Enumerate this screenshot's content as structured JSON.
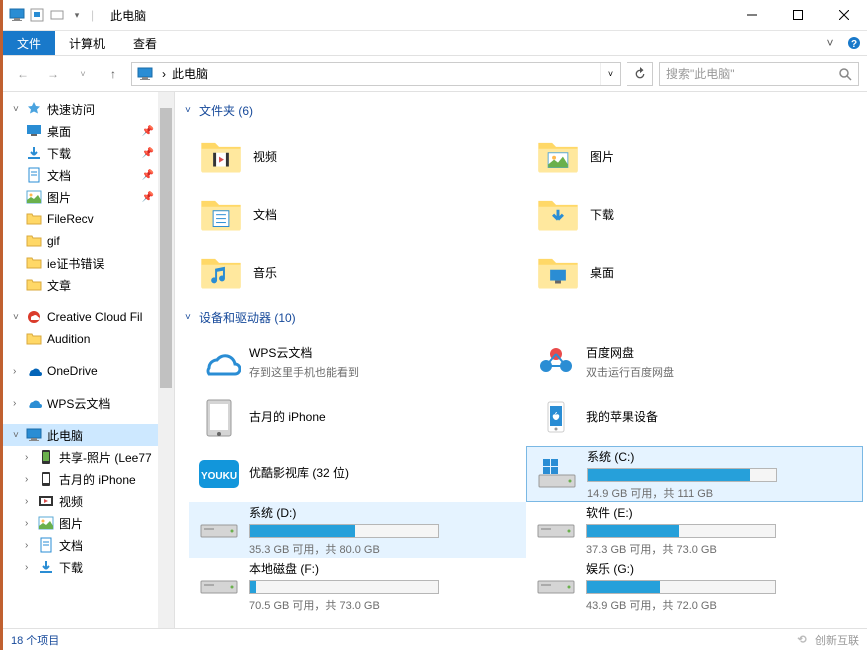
{
  "title_bar": {
    "title": "此电脑"
  },
  "ribbon": {
    "file": "文件",
    "computer": "计算机",
    "view": "查看"
  },
  "address": {
    "separator": "›",
    "path": "此电脑",
    "search_placeholder": "搜索\"此电脑\""
  },
  "sidebar": {
    "quickaccess": {
      "label": "快速访问"
    },
    "quickaccess_items": [
      {
        "label": "桌面",
        "pinned": true,
        "icon": "desktop"
      },
      {
        "label": "下载",
        "pinned": true,
        "icon": "downloads"
      },
      {
        "label": "文档",
        "pinned": true,
        "icon": "documents"
      },
      {
        "label": "图片",
        "pinned": true,
        "icon": "pictures"
      },
      {
        "label": "FileRecv",
        "pinned": false,
        "icon": "folder"
      },
      {
        "label": "gif",
        "pinned": false,
        "icon": "folder"
      },
      {
        "label": "ie证书错误",
        "pinned": false,
        "icon": "folder"
      },
      {
        "label": "文章",
        "pinned": false,
        "icon": "folder"
      }
    ],
    "cloud": [
      {
        "label": "Creative Cloud Fil",
        "icon": "cc"
      },
      {
        "label": "Audition",
        "icon": "folder",
        "lvl": 1
      }
    ],
    "onedrive": {
      "label": "OneDrive"
    },
    "wps": {
      "label": "WPS云文档"
    },
    "thispc": {
      "label": "此电脑"
    },
    "thispc_items": [
      {
        "label": "共享-照片 (Lee77",
        "icon": "phone-green"
      },
      {
        "label": "古月的 iPhone",
        "icon": "phone"
      },
      {
        "label": "视频",
        "icon": "videos"
      },
      {
        "label": "图片",
        "icon": "pictures"
      },
      {
        "label": "文档",
        "icon": "documents"
      },
      {
        "label": "下载",
        "icon": "downloads"
      }
    ]
  },
  "content": {
    "folders_header": "文件夹 (6)",
    "folders": [
      {
        "name": "视频",
        "icon": "videos"
      },
      {
        "name": "图片",
        "icon": "pictures"
      },
      {
        "name": "文档",
        "icon": "documents"
      },
      {
        "name": "下载",
        "icon": "downloads"
      },
      {
        "name": "音乐",
        "icon": "music"
      },
      {
        "name": "桌面",
        "icon": "desktop"
      }
    ],
    "devices_header": "设备和驱动器 (10)",
    "devices": [
      {
        "title": "WPS云文档",
        "sub": "存到这里手机也能看到",
        "icon": "wps-cloud"
      },
      {
        "title": "百度网盘",
        "sub": "双击运行百度网盘",
        "icon": "baidu"
      },
      {
        "title": "古月的 iPhone",
        "sub": "",
        "icon": "phone-device"
      },
      {
        "title": "我的苹果设备",
        "sub": "",
        "icon": "apple-device"
      },
      {
        "title": "优酷影视库 (32 位)",
        "sub": "",
        "icon": "youku"
      },
      {
        "title": "系统 (C:)",
        "sub": "14.9 GB 可用，共 111 GB",
        "icon": "drive-win",
        "bar_pct": 86,
        "selected": true
      },
      {
        "title": "系统 (D:)",
        "sub": "35.3 GB 可用，共 80.0 GB",
        "icon": "drive",
        "bar_pct": 56,
        "hilite": true
      },
      {
        "title": "软件 (E:)",
        "sub": "37.3 GB 可用，共 73.0 GB",
        "icon": "drive",
        "bar_pct": 49
      },
      {
        "title": "本地磁盘 (F:)",
        "sub": "70.5 GB 可用，共 73.0 GB",
        "icon": "drive",
        "bar_pct": 3
      },
      {
        "title": "娱乐 (G:)",
        "sub": "43.9 GB 可用，共 72.0 GB",
        "icon": "drive",
        "bar_pct": 39
      }
    ]
  },
  "status_bar": {
    "count": "18 个项目",
    "watermark": "创新互联"
  }
}
